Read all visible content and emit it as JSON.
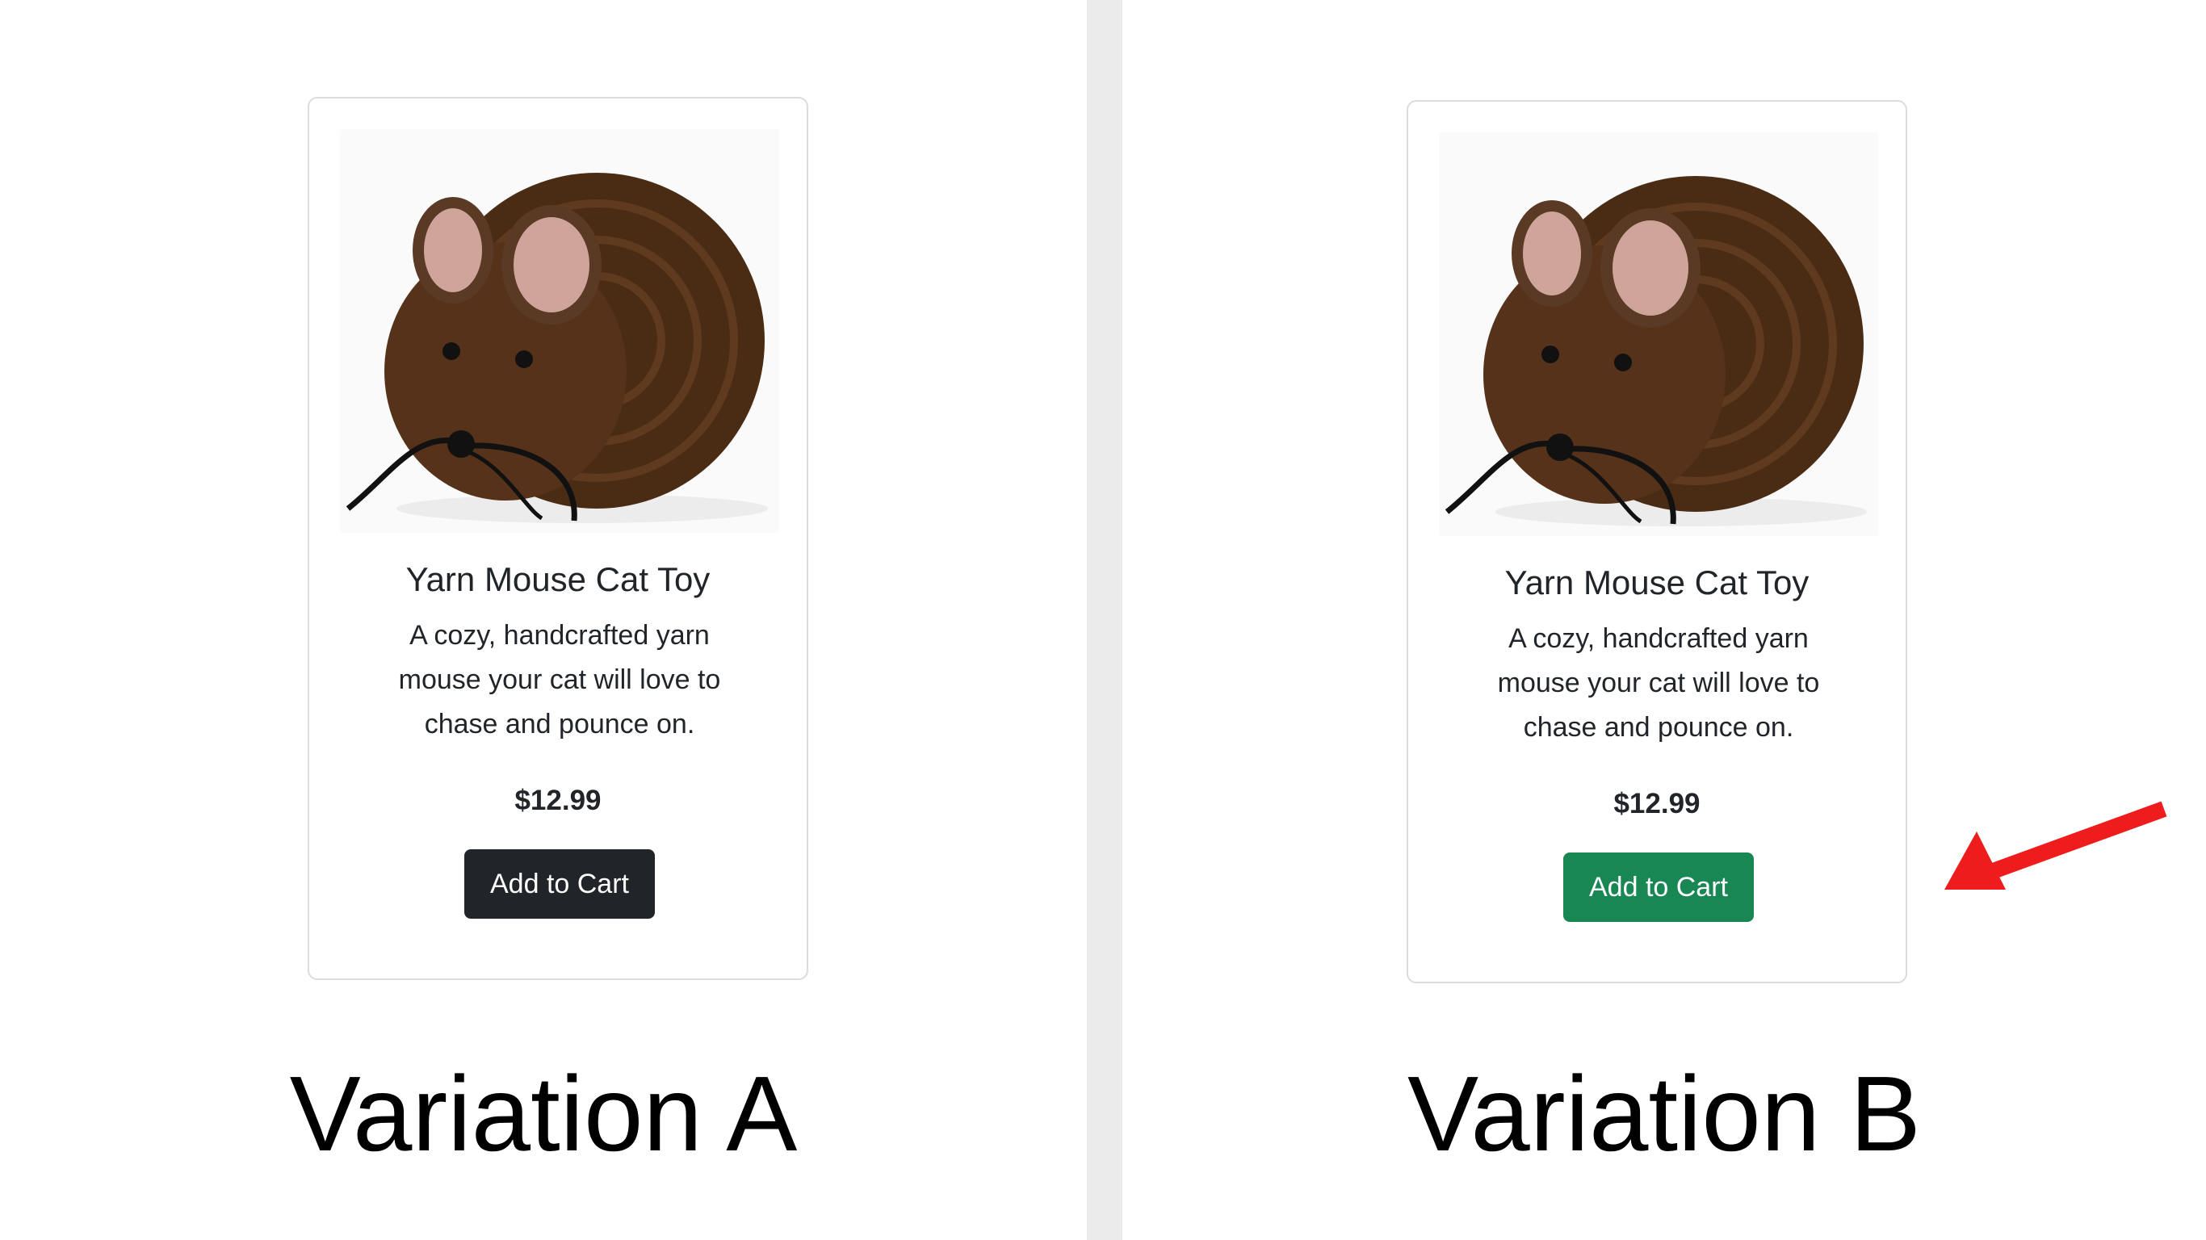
{
  "variations": [
    {
      "label": "Variation A",
      "product": {
        "image_icon": "yarn-mouse-image",
        "title": "Yarn Mouse Cat Toy",
        "description": "A cozy, handcrafted yarn mouse your cat will love to chase and pounce on.",
        "price": "$12.99",
        "button_label": "Add to Cart",
        "button_color": "#212529"
      }
    },
    {
      "label": "Variation B",
      "product": {
        "image_icon": "yarn-mouse-image",
        "title": "Yarn Mouse Cat Toy",
        "description": "A cozy, handcrafted yarn mouse your cat will love to chase and pounce on.",
        "price": "$12.99",
        "button_label": "Add to Cart",
        "button_color": "#198754"
      }
    }
  ],
  "annotation": {
    "icon": "red-arrow-icon",
    "color": "#ee1c1c"
  },
  "colors": {
    "divider": "#ebebeb",
    "card_border": "#dcdcdc",
    "text": "#212529"
  }
}
